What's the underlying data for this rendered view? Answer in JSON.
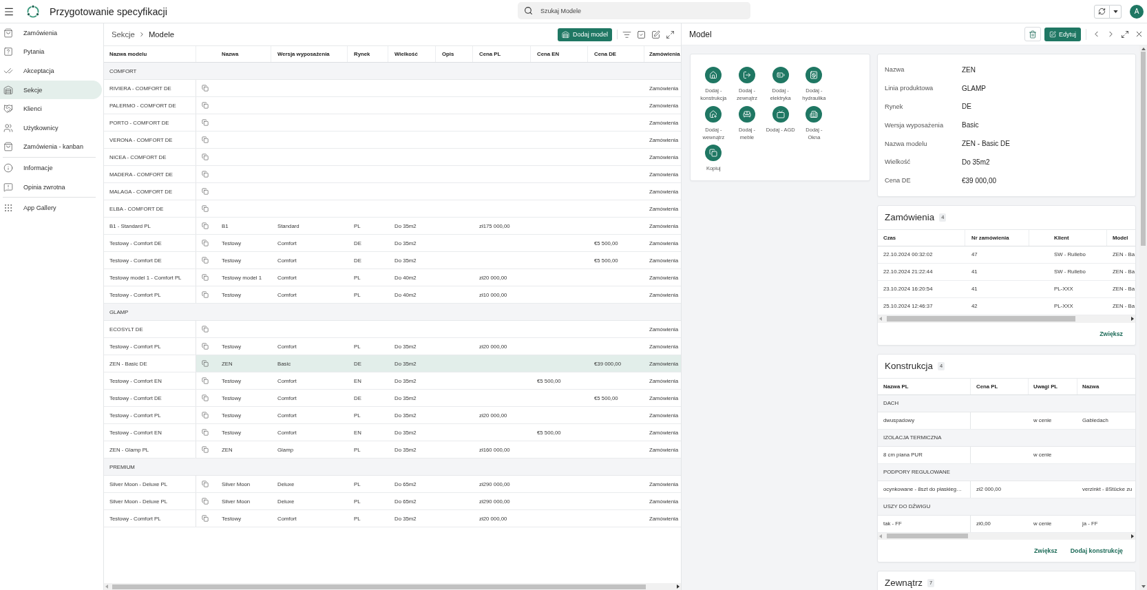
{
  "header": {
    "title": "Przygotowanie specyfikacji",
    "search": {
      "placeholder": "Szukaj Modele"
    },
    "avatar": "A"
  },
  "sidebar": {
    "groups": [
      {
        "items": [
          {
            "label": "Zamówienia",
            "selected": false
          },
          {
            "label": "Pytania",
            "selected": false
          },
          {
            "label": "Akceptacja",
            "selected": false
          },
          {
            "label": "Sekcje",
            "selected": true
          },
          {
            "label": "Klienci",
            "selected": false
          },
          {
            "label": "Użytkownicy",
            "selected": false
          },
          {
            "label": "Zamówienia - kanban",
            "selected": false
          }
        ]
      },
      {
        "items": [
          {
            "label": "Informacje",
            "selected": false
          },
          {
            "label": "Opinia zwrotna",
            "selected": false
          }
        ]
      },
      {
        "items": [
          {
            "label": "App Gallery",
            "selected": false
          }
        ]
      }
    ]
  },
  "list": {
    "breadcrumb": [
      "Sekcje",
      "Modele"
    ],
    "add_button": "Dodaj model",
    "table": {
      "columns": [
        "Nazwa modelu",
        "Nazwa",
        "Wersja wyposażenia",
        "Rynek",
        "Wielkość",
        "Opis",
        "Cena PL",
        "Cena EN",
        "Cena DE",
        "Zamówienia"
      ],
      "groups": [
        {
          "name": "COMFORT",
          "rows": [
            {
              "model": "RIVIERA - COMFORT DE",
              "orders": "Zamówienia",
              "selected": false
            },
            {
              "model": "PALERMO - COMFORT DE",
              "orders": "Zamówienia",
              "selected": false
            },
            {
              "model": "PORTO - COMFORT DE",
              "orders": "Zamówienia",
              "selected": false
            },
            {
              "model": "VERONA - COMFORT DE",
              "orders": "Zamówienia",
              "selected": false
            },
            {
              "model": "NICEA - COMFORT DE",
              "orders": "Zamówienia",
              "selected": false
            },
            {
              "model": "MADERA - COMFORT DE",
              "orders": "Zamówienia",
              "selected": false
            },
            {
              "model": "MALAGA - COMFORT DE",
              "orders": "Zamówienia",
              "selected": false
            },
            {
              "model": "ELBA - COMFORT DE",
              "orders": "Zamówienia",
              "selected": false
            },
            {
              "model": "B1 - Standard PL",
              "name": "B1",
              "version": "Standard",
              "market": "PL",
              "size": "Do 35m2",
              "price_pl": "zł175 000,00",
              "orders": "Zamówienia",
              "selected": false
            },
            {
              "model": "Testowy - Comfort DE",
              "name": "Testowy",
              "version": "Comfort",
              "market": "DE",
              "size": "Do 35m2",
              "price_de": "€5 500,00",
              "orders": "Zamówienia",
              "selected": false
            },
            {
              "model": "Testowy - Comfort DE",
              "name": "Testowy",
              "version": "Comfort",
              "market": "DE",
              "size": "Do 35m2",
              "price_de": "€5 500,00",
              "orders": "Zamówienia",
              "selected": false
            },
            {
              "model": "Testowy model 1 - Comfort PL",
              "name": "Testowy model 1",
              "version": "Comfort",
              "market": "PL",
              "size": "Do 40m2",
              "price_pl": "zł20 000,00",
              "orders": "Zamówienia",
              "selected": false
            },
            {
              "model": "Testowy - Comfort PL",
              "name": "Testowy",
              "version": "Comfort",
              "market": "PL",
              "size": "Do 40m2",
              "price_pl": "zł10 000,00",
              "orders": "Zamówienia",
              "selected": false
            }
          ]
        },
        {
          "name": "GLAMP",
          "rows": [
            {
              "model": "ECOSYLT DE",
              "orders": "Zamówienia",
              "selected": false
            },
            {
              "model": "Testowy - Comfort PL",
              "name": "Testowy",
              "version": "Comfort",
              "market": "PL",
              "size": "Do 35m2",
              "price_pl": "zł20 000,00",
              "orders": "Zamówienia",
              "selected": false
            },
            {
              "model": "ZEN - Basic DE",
              "name": "ZEN",
              "version": "Basic",
              "market": "DE",
              "size": "Do 35m2",
              "price_de": "€39 000,00",
              "orders": "Zamówienia",
              "selected": true
            },
            {
              "model": "Testowy - Comfort EN",
              "name": "Testowy",
              "version": "Comfort",
              "market": "EN",
              "size": "Do 35m2",
              "price_en": "€5 500,00",
              "orders": "Zamówienia",
              "selected": false
            },
            {
              "model": "Testowy - Comfort DE",
              "name": "Testowy",
              "version": "Comfort",
              "market": "DE",
              "size": "Do 35m2",
              "price_de": "€5 500,00",
              "orders": "Zamówienia",
              "selected": false
            },
            {
              "model": "Testowy - Comfort PL",
              "name": "Testowy",
              "version": "Comfort",
              "market": "PL",
              "size": "Do 35m2",
              "price_pl": "zł20 000,00",
              "orders": "Zamówienia",
              "selected": false
            },
            {
              "model": "Testowy - Comfort EN",
              "name": "Testowy",
              "version": "Comfort",
              "market": "EN",
              "size": "Do 35m2",
              "price_en": "€5 500,00",
              "orders": "Zamówienia",
              "selected": false
            },
            {
              "model": "ZEN - Glamp PL",
              "name": "ZEN",
              "version": "Glamp",
              "market": "PL",
              "size": "Do 35m2",
              "price_pl": "zł160 000,00",
              "orders": "Zamówienia",
              "selected": false
            }
          ]
        },
        {
          "name": "PREMIUM",
          "rows": [
            {
              "model": "Silver Moon - Deluxe PL",
              "name": "Silver Moon",
              "version": "Deluxe",
              "market": "PL",
              "size": "Do 65m2",
              "price_pl": "zł290 000,00",
              "orders": "Zamówienia",
              "selected": false
            },
            {
              "model": "Silver Moon - Deluxe PL",
              "name": "Silver Moon",
              "version": "Deluxe",
              "market": "PL",
              "size": "Do 65m2",
              "price_pl": "zł290 000,00",
              "orders": "Zamówienia",
              "selected": false
            },
            {
              "model": "Testowy - Comfort PL",
              "name": "Testowy",
              "version": "Comfort",
              "market": "PL",
              "size": "Do 35m2",
              "price_pl": "zł20 000,00",
              "orders": "Zamówienia",
              "selected": false
            }
          ]
        }
      ]
    }
  },
  "detail": {
    "title": "Model",
    "edit_button": "Edytuj",
    "actions": [
      "Dodaj - konstrukcja",
      "Dodaj - zewnątrz",
      "Dodaj - elektryka",
      "Dodaj - hydraulika",
      "Dodaj - wewnątrz",
      "Dodaj - meble",
      "Dodaj - AGD",
      "Dodaj - Okna",
      "Kopiuj"
    ],
    "fields": [
      {
        "label": "Nazwa",
        "value": "ZEN"
      },
      {
        "label": "Linia produktowa",
        "value": "GLAMP"
      },
      {
        "label": "Rynek",
        "value": "DE"
      },
      {
        "label": "Wersja wyposażenia",
        "value": "Basic"
      },
      {
        "label": "Nazwa modelu",
        "value": "ZEN - Basic DE"
      },
      {
        "label": "Wielkość",
        "value": "Do 35m2"
      },
      {
        "label": "Cena DE",
        "value": "€39 000,00"
      }
    ],
    "orders": {
      "title": "Zamówienia",
      "count": "4",
      "columns": [
        "Czas",
        "Nr zamówienia",
        "Klient",
        "Model"
      ],
      "rows": [
        {
          "time": "22.10.2024 00:32:02",
          "number": "47",
          "client": "SW - Rullebo",
          "model": "ZEN - Ba"
        },
        {
          "time": "22.10.2024 21:22:44",
          "number": "41",
          "client": "SW - Rullebo",
          "model": "ZEN - Ba"
        },
        {
          "time": "23.10.2024 16:20:54",
          "number": "41",
          "client": "PL-XXX",
          "model": "ZEN - Ba"
        },
        {
          "time": "25.10.2024 12:46:37",
          "number": "42",
          "client": "PL-XXX",
          "model": "ZEN - Ba"
        }
      ],
      "more_link": "Zwiększ"
    },
    "construction": {
      "title": "Konstrukcja",
      "count": "4",
      "columns": [
        "Nazwa PL",
        "Cena PL",
        "Uwagi PL",
        "Nazwa"
      ],
      "groups": [
        {
          "name": "DACH",
          "rows": [
            {
              "name_pl": "dwuspadowy",
              "notes_pl": "w cenie",
              "name": "Gabledach"
            }
          ]
        },
        {
          "name": "IZOLACJA TERMICZNA",
          "rows": [
            {
              "name_pl": "8 cm piana PUR",
              "notes_pl": "w cenie"
            }
          ]
        },
        {
          "name": "PODPORY REGULOWANE",
          "rows": [
            {
              "name_pl": "ocynkowane - 8szt do płaskieg…",
              "price_pl": "zł2 000,00",
              "name": "verzinkt - 8Stücke zu"
            }
          ]
        },
        {
          "name": "USZY DO DŹWIGU",
          "rows": [
            {
              "name_pl": "tak - FF",
              "price_pl": "zł0,00",
              "notes_pl": "w cenie",
              "name": "ja - FF"
            }
          ]
        }
      ],
      "more_link": "Zwiększ",
      "add_link": "Dodaj konstrukcję"
    },
    "exterior": {
      "title": "Zewnątrz",
      "count": "7"
    }
  }
}
